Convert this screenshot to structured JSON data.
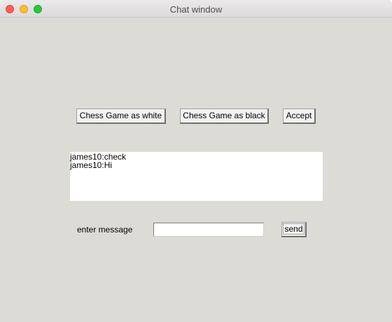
{
  "window": {
    "title": "Chat window",
    "controls": {
      "close": "close-icon",
      "minimize": "minimize-icon",
      "zoom": "zoom-icon"
    }
  },
  "buttons": {
    "white_label": "Chess Game as white",
    "black_label": "Chess Game as black",
    "accept_label": "Accept",
    "send_label": "send"
  },
  "chat": {
    "messages": [
      "james10:check",
      "james10:Hi"
    ]
  },
  "composer": {
    "label": "enter message",
    "value": ""
  },
  "colors": {
    "window_bg": "#dddbd6",
    "close": "#fe5f57",
    "minimize": "#febc2e",
    "zoom": "#28c840"
  }
}
